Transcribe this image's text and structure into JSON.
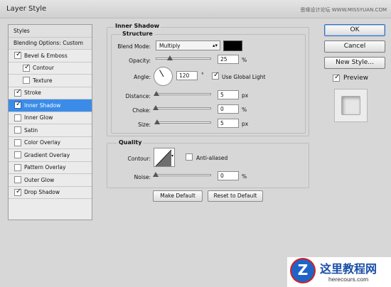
{
  "window": {
    "title": "Layer Style",
    "watermark": "思缘设计论坛 WWW.MISSYUAN.COM"
  },
  "styles_list": {
    "items": [
      {
        "label": "Styles",
        "header": true
      },
      {
        "label": "Blending Options: Custom",
        "header": true
      },
      {
        "label": "Bevel & Emboss",
        "checked": true
      },
      {
        "label": "Contour",
        "checked": true,
        "indent": true
      },
      {
        "label": "Texture",
        "checked": false,
        "indent": true
      },
      {
        "label": "Stroke",
        "checked": true
      },
      {
        "label": "Inner Shadow",
        "checked": true,
        "selected": true
      },
      {
        "label": "Inner Glow",
        "checked": false
      },
      {
        "label": "Satin",
        "checked": false
      },
      {
        "label": "Color Overlay",
        "checked": false
      },
      {
        "label": "Gradient Overlay",
        "checked": false
      },
      {
        "label": "Pattern Overlay",
        "checked": false
      },
      {
        "label": "Outer Glow",
        "checked": false
      },
      {
        "label": "Drop Shadow",
        "checked": true
      }
    ]
  },
  "inner_shadow": {
    "section_title": "Inner Shadow",
    "structure_title": "Structure",
    "blend_mode_label": "Blend Mode:",
    "blend_mode_value": "Multiply",
    "shadow_color": "#000000",
    "opacity_label": "Opacity:",
    "opacity_value": "25",
    "opacity_unit": "%",
    "opacity_fraction": 0.25,
    "angle_label": "Angle:",
    "angle_value": "120",
    "angle_unit": "°",
    "use_global_light_label": "Use Global Light",
    "use_global_light_checked": true,
    "distance_label": "Distance:",
    "distance_value": "5",
    "distance_unit": "px",
    "choke_label": "Choke:",
    "choke_value": "0",
    "choke_unit": "%",
    "size_label": "Size:",
    "size_value": "5",
    "size_unit": "px"
  },
  "quality": {
    "title": "Quality",
    "contour_label": "Contour:",
    "anti_aliased_label": "Anti-aliased",
    "anti_aliased_checked": false,
    "noise_label": "Noise:",
    "noise_value": "0",
    "noise_unit": "%"
  },
  "actions": {
    "make_default": "Make Default",
    "reset_to_default": "Reset to Default"
  },
  "dialog_buttons": {
    "ok": "OK",
    "cancel": "Cancel",
    "new_style": "New Style...",
    "preview_label": "Preview",
    "preview_checked": true
  },
  "logo": {
    "mark": "Z",
    "name": "这里教程网",
    "site": "herecours.com"
  }
}
